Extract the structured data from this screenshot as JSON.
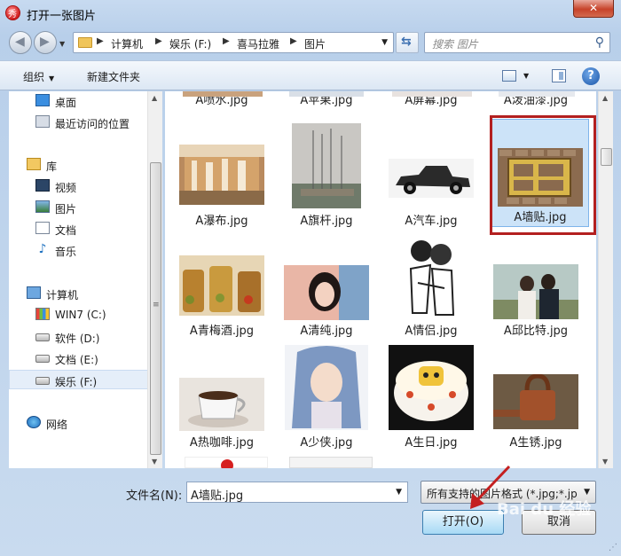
{
  "window": {
    "title": "打开一张图片"
  },
  "address": {
    "crumbs": [
      "计算机",
      "娱乐 (F:)",
      "喜马拉雅",
      "图片"
    ]
  },
  "search": {
    "placeholder": "搜索 图片"
  },
  "toolbar": {
    "organize": "组织",
    "new_folder": "新建文件夹"
  },
  "sidebar": {
    "items": [
      {
        "label": "桌面",
        "icon": "desktop-icon"
      },
      {
        "label": "最近访问的位置",
        "icon": "recent-places-icon"
      },
      {
        "label": "库",
        "icon": "library-icon"
      },
      {
        "label": "视频",
        "icon": "video-icon"
      },
      {
        "label": "图片",
        "icon": "pictures-icon"
      },
      {
        "label": "文档",
        "icon": "documents-icon"
      },
      {
        "label": "音乐",
        "icon": "music-icon"
      },
      {
        "label": "计算机",
        "icon": "computer-icon"
      },
      {
        "label": "WIN7 (C:)",
        "icon": "windows-drive-icon"
      },
      {
        "label": "软件 (D:)",
        "icon": "drive-icon"
      },
      {
        "label": "文档 (E:)",
        "icon": "drive-icon"
      },
      {
        "label": "娱乐 (F:)",
        "icon": "drive-icon"
      },
      {
        "label": "网络",
        "icon": "network-icon"
      }
    ]
  },
  "files": [
    "A喷水.jpg",
    "A苹果.jpg",
    "A屏幕.jpg",
    "A泼油漆.jpg",
    "A瀑布.jpg",
    "A旗杆.jpg",
    "A汽车.jpg",
    "A墙贴.jpg",
    "A青梅酒.jpg",
    "A清纯.jpg",
    "A情侣.jpg",
    "A邱比特.jpg",
    "A热咖啡.jpg",
    "A少侠.jpg",
    "A生日.jpg",
    "A生锈.jpg"
  ],
  "bottom": {
    "filename_label": "文件名(N):",
    "filename_value": "A墙贴.jpg",
    "filter_value": "所有支持的图片格式 (*.jpg;*.jp",
    "open_label": "打开(O)",
    "cancel_label": "取消"
  },
  "colors": {
    "selection_outline": "#b32020",
    "accent": "#3c7fb1"
  }
}
